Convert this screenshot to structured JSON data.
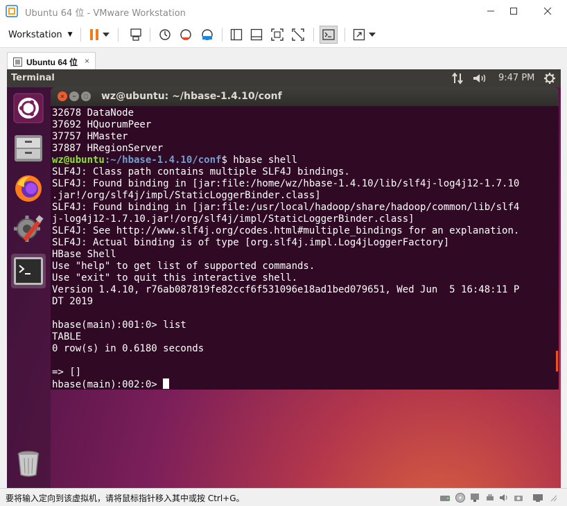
{
  "window": {
    "title": "Ubuntu 64 位 - VMware Workstation",
    "minimize_icon": "minimize-icon",
    "maximize_icon": "maximize-icon",
    "close_icon": "close-icon"
  },
  "toolbar": {
    "workstation_menu": "Workstation",
    "items": [
      "pause-icon",
      "send-ctrl-alt-del-icon",
      "snapshot-icon",
      "revert-snapshot-icon",
      "manage-snapshots-icon",
      "library-icon",
      "console-view-icon",
      "full-screen-icon",
      "unity-icon",
      "terminal-view-icon",
      "stretch-icon"
    ]
  },
  "tabs": [
    {
      "label": "Ubuntu 64 位",
      "close": "×"
    }
  ],
  "vm": {
    "topbar": {
      "app_name": "Terminal",
      "clock": "9:47 PM"
    },
    "launcher": [
      "ubuntu-icon",
      "files-icon",
      "firefox-icon",
      "settings-icon",
      "terminal-icon",
      "trash-icon"
    ],
    "terminal": {
      "title": "wz@ubuntu: ~/hbase-1.4.10/conf",
      "lines_top": [
        "32678 DataNode",
        "37692 HQuorumPeer",
        "37757 HMaster",
        "37887 HRegionServer"
      ],
      "prompt_user": "wz@ubuntu",
      "prompt_path": ":~/hbase-1.4.10/conf",
      "prompt_command": "$ hbase shell",
      "lines_output": [
        "SLF4J: Class path contains multiple SLF4J bindings.",
        "SLF4J: Found binding in [jar:file:/home/wz/hbase-1.4.10/lib/slf4j-log4j12-1.7.10",
        ".jar!/org/slf4j/impl/StaticLoggerBinder.class]",
        "SLF4J: Found binding in [jar:file:/usr/local/hadoop/share/hadoop/common/lib/slf4",
        "j-log4j12-1.7.10.jar!/org/slf4j/impl/StaticLoggerBinder.class]",
        "SLF4J: See http://www.slf4j.org/codes.html#multiple_bindings for an explanation.",
        "SLF4J: Actual binding is of type [org.slf4j.impl.Log4jLoggerFactory]",
        "HBase Shell",
        "Use \"help\" to get list of supported commands.",
        "Use \"exit\" to quit this interactive shell.",
        "Version 1.4.10, r76ab087819fe82ccf6f531096e18ad1bed079651, Wed Jun  5 16:48:11 P",
        "DT 2019",
        "",
        "hbase(main):001:0> list",
        "TABLE",
        "0 row(s) in 0.6180 seconds",
        "",
        "=> []"
      ],
      "current_prompt": "hbase(main):002:0> "
    }
  },
  "statusbar": {
    "message": "要将输入定向到该虚拟机，请将鼠标指针移入其中或按 Ctrl+G。"
  },
  "colors": {
    "terminal_bg": "#300a24",
    "prompt_user": "#8ae234",
    "prompt_path": "#729fcf",
    "ubuntu_orange": "#e95420"
  }
}
